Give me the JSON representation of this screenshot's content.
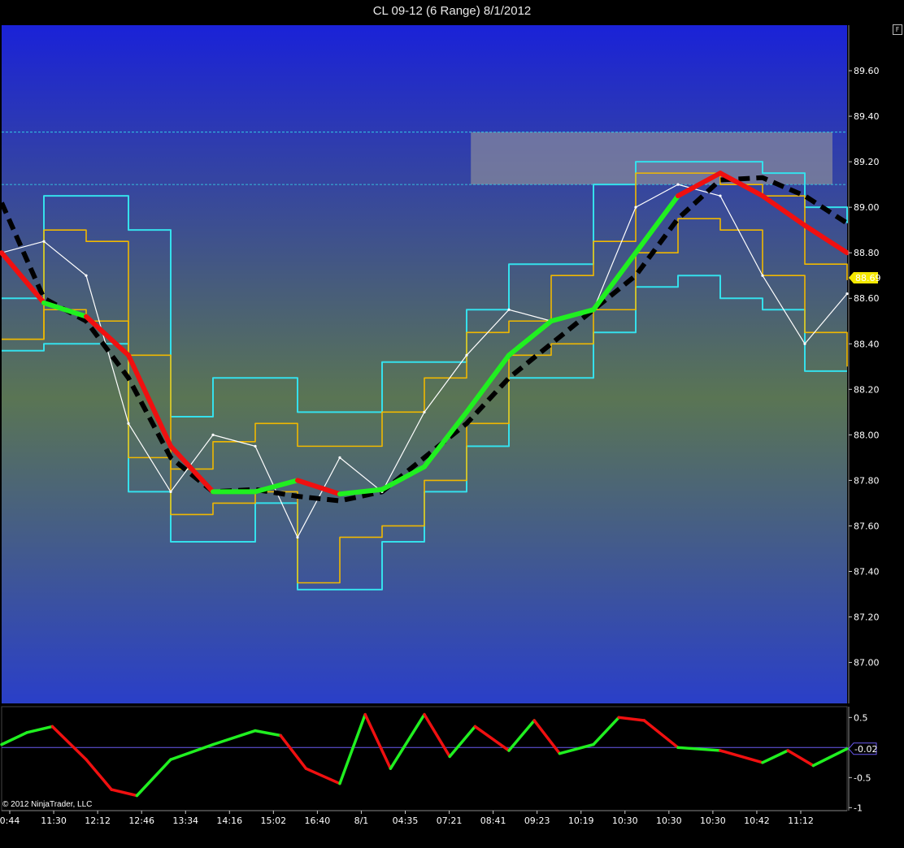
{
  "window": {
    "title": "CL 09-12 (6 Range)  8/1/2012",
    "format_button": "F",
    "copyright": "© 2012 NinjaTrader, LLC"
  },
  "colors": {
    "panel_top": "#1a22d8",
    "panel_mid": "#5a7554",
    "panel_bottom": "#2a3fc8",
    "channel": "#35e0ec",
    "inner_channel": "#f0b800",
    "price": "#ffffff",
    "trend_up": "#20f020",
    "trend_down": "#f01010",
    "baseline": "#000000",
    "zone": "#9a9a9a",
    "osc_line": "#6a5af0"
  },
  "chart_data": [
    {
      "type": "line",
      "panel": "price",
      "y_ticks": [
        "89.60",
        "89.40",
        "89.20",
        "89.00",
        "88.80",
        "88.60",
        "88.40",
        "88.20",
        "88.00",
        "87.80",
        "87.60",
        "87.40",
        "87.20",
        "87.00"
      ],
      "ylim": [
        86.82,
        89.8
      ],
      "last_price": "88.69",
      "x_ticks": [
        "0:44",
        "11:30",
        "12:12",
        "12:46",
        "13:34",
        "14:16",
        "15:02",
        "16:40",
        "8/1",
        "04:35",
        "07:21",
        "08:41",
        "09:23",
        "10:19",
        "10:30",
        "10:30",
        "10:30",
        "10:42",
        "11:12"
      ],
      "zone": {
        "x_from": 0.555,
        "x_to": 1.0,
        "y_from": 89.1,
        "y_to": 89.33
      },
      "zone_lines": [
        89.33,
        89.1
      ],
      "x": [
        0,
        0.05,
        0.1,
        0.15,
        0.2,
        0.25,
        0.3,
        0.35,
        0.4,
        0.45,
        0.5,
        0.55,
        0.6,
        0.65,
        0.7,
        0.75,
        0.8,
        0.85,
        0.9,
        0.95,
        1.0
      ],
      "series": [
        {
          "role": "price",
          "values": [
            88.8,
            88.85,
            88.7,
            88.05,
            87.75,
            88.0,
            87.95,
            87.55,
            87.9,
            87.75,
            88.1,
            88.35,
            88.55,
            88.5,
            88.55,
            89.0,
            89.1,
            89.05,
            88.7,
            88.4,
            88.62
          ]
        },
        {
          "role": "trend",
          "values": [
            88.8,
            88.58,
            88.52,
            88.35,
            87.95,
            87.75,
            87.75,
            87.8,
            87.74,
            87.76,
            87.86,
            88.1,
            88.35,
            88.5,
            88.55,
            88.8,
            89.05,
            89.15,
            89.05,
            88.92,
            88.8
          ],
          "states": [
            "down",
            "down",
            "up",
            "down",
            "down",
            "down",
            "up",
            "up",
            "down",
            "up",
            "up",
            "up",
            "up",
            "up",
            "up",
            "up",
            "up",
            "down",
            "down",
            "down",
            "down"
          ]
        },
        {
          "role": "baseline",
          "values": [
            89.02,
            88.6,
            88.5,
            88.25,
            87.9,
            87.75,
            87.76,
            87.73,
            87.71,
            87.75,
            87.9,
            88.05,
            88.25,
            88.4,
            88.55,
            88.7,
            88.95,
            89.12,
            89.13,
            89.05,
            88.93
          ]
        },
        {
          "role": "upper_channel",
          "values": [
            88.6,
            89.05,
            89.05,
            88.9,
            88.08,
            88.25,
            88.25,
            88.1,
            88.1,
            88.32,
            88.32,
            88.55,
            88.75,
            88.75,
            89.1,
            89.2,
            89.2,
            89.2,
            89.15,
            89.0,
            88.93
          ]
        },
        {
          "role": "lower_channel",
          "values": [
            88.37,
            88.4,
            88.4,
            87.75,
            87.53,
            87.53,
            87.7,
            87.32,
            87.32,
            87.53,
            87.75,
            87.95,
            88.25,
            88.25,
            88.45,
            88.65,
            88.7,
            88.6,
            88.55,
            88.28,
            88.28
          ]
        },
        {
          "role": "inner_upper",
          "values": [
            88.42,
            88.9,
            88.85,
            88.35,
            87.85,
            87.97,
            88.05,
            87.95,
            87.95,
            88.1,
            88.25,
            88.45,
            88.5,
            88.7,
            88.85,
            89.15,
            89.15,
            89.1,
            89.05,
            88.75,
            88.68
          ]
        },
        {
          "role": "inner_lower",
          "values": [
            88.42,
            88.55,
            88.5,
            87.9,
            87.65,
            87.7,
            87.75,
            87.35,
            87.55,
            87.6,
            87.8,
            88.05,
            88.35,
            88.4,
            88.55,
            88.8,
            88.95,
            88.9,
            88.7,
            88.45,
            88.3
          ]
        }
      ]
    },
    {
      "type": "line",
      "panel": "oscillator",
      "y_ticks": [
        "0.5",
        "-0.5",
        "-1"
      ],
      "ylim": [
        -1.05,
        0.68
      ],
      "last_value": "-0.02",
      "x": [
        0,
        0.03,
        0.06,
        0.1,
        0.13,
        0.16,
        0.2,
        0.25,
        0.3,
        0.33,
        0.36,
        0.4,
        0.43,
        0.46,
        0.5,
        0.53,
        0.56,
        0.6,
        0.63,
        0.66,
        0.7,
        0.73,
        0.76,
        0.8,
        0.85,
        0.9,
        0.93,
        0.96,
        1.0
      ],
      "series": [
        {
          "role": "oscillator",
          "values": [
            0.05,
            0.25,
            0.35,
            -0.2,
            -0.7,
            -0.8,
            -0.2,
            0.05,
            0.28,
            0.2,
            -0.35,
            -0.6,
            0.55,
            -0.35,
            0.55,
            -0.15,
            0.35,
            -0.05,
            0.45,
            -0.1,
            0.05,
            0.5,
            0.45,
            0.0,
            -0.05,
            -0.25,
            -0.05,
            -0.3,
            -0.02
          ],
          "states": [
            "up",
            "up",
            "up",
            "down",
            "down",
            "down",
            "up",
            "up",
            "up",
            "up",
            "down",
            "down",
            "up",
            "down",
            "up",
            "down",
            "up",
            "down",
            "up",
            "down",
            "up",
            "up",
            "down",
            "down",
            "up",
            "down",
            "up",
            "down",
            "up"
          ]
        }
      ]
    }
  ]
}
